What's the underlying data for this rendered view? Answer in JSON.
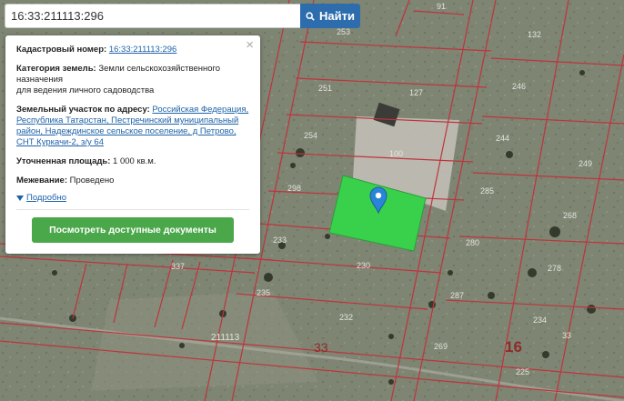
{
  "search": {
    "value": "16:33:211113:296",
    "button_label": "Найти"
  },
  "info": {
    "close_glyph": "×",
    "cadastral_label": "Кадастровый номер:",
    "cadastral_value": "16:33:211113:296",
    "category_label": "Категория земель:",
    "category_value": "Земли сельскохозяйственного назначения",
    "category_use": "для ведения личного садоводства",
    "address_label": "Земельный участок по адресу:",
    "address_value": "Российская Федерация, Республика Татарстан, Пестречинский муниципальный район, Надеждинское сельское поселение, д Петрово, СНТ Куркачи-2, з/у 64",
    "area_label": "Уточненная площадь:",
    "area_value": "1 000 кв.м.",
    "survey_label": "Межевание:",
    "survey_value": "Проведено",
    "more_label": "Подробно",
    "docs_button": "Посмотреть доступные документы"
  },
  "map": {
    "parcels": [
      "91",
      "253",
      "132",
      "251",
      "246",
      "127",
      "254",
      "100",
      "244",
      "249",
      "298",
      "285",
      "268",
      "233",
      "280",
      "337",
      "278",
      "230",
      "235",
      "287",
      "232",
      "234",
      "269",
      "225",
      "33"
    ],
    "block_label": "211113",
    "road_label": "33",
    "quarter_label": "16",
    "colors": {
      "selected_parcel": "#39d14c",
      "parcel_border": "#c0333d",
      "marker": "#2a84d8"
    }
  }
}
